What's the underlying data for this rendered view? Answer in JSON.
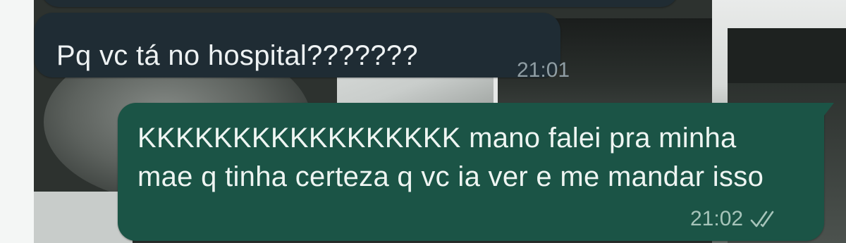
{
  "chat": {
    "messages": [
      {
        "direction": "incoming",
        "text": "Pq vc tá no hospital???????",
        "time": "21:01"
      },
      {
        "direction": "outgoing",
        "text": "KKKKKKKKKKKKKKKKK mano falei pra minha mae q tinha certeza q vc ia ver e me mandar isso",
        "time": "21:02",
        "status_icon": "double-check-read-icon"
      }
    ]
  },
  "colors": {
    "incoming_bubble": "#1f2c34",
    "outgoing_bubble": "#1b5446",
    "message_text": "#eef2f3",
    "timestamp_incoming": "#8f9da3",
    "timestamp_outgoing": "#a6c4ba"
  }
}
